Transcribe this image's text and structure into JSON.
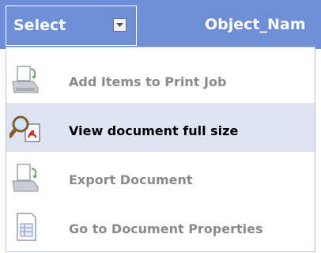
{
  "header": {
    "select_label": "Select",
    "object_name_label": "Object_Nam"
  },
  "menu": {
    "items": [
      {
        "label": "Add Items to Print Job",
        "icon": "add-to-print-icon",
        "highlighted": false
      },
      {
        "label": "View document full size",
        "icon": "magnifier-document-icon",
        "highlighted": true
      },
      {
        "label": "Export Document",
        "icon": "export-document-icon",
        "highlighted": false
      },
      {
        "label": "Go to Document Properties",
        "icon": "document-properties-icon",
        "highlighted": false
      }
    ]
  },
  "colors": {
    "header_bg": "#6e8ed6",
    "highlight_bg": "#dfe4f1",
    "disabled_text": "#8a8a8a",
    "active_text": "#000000"
  }
}
